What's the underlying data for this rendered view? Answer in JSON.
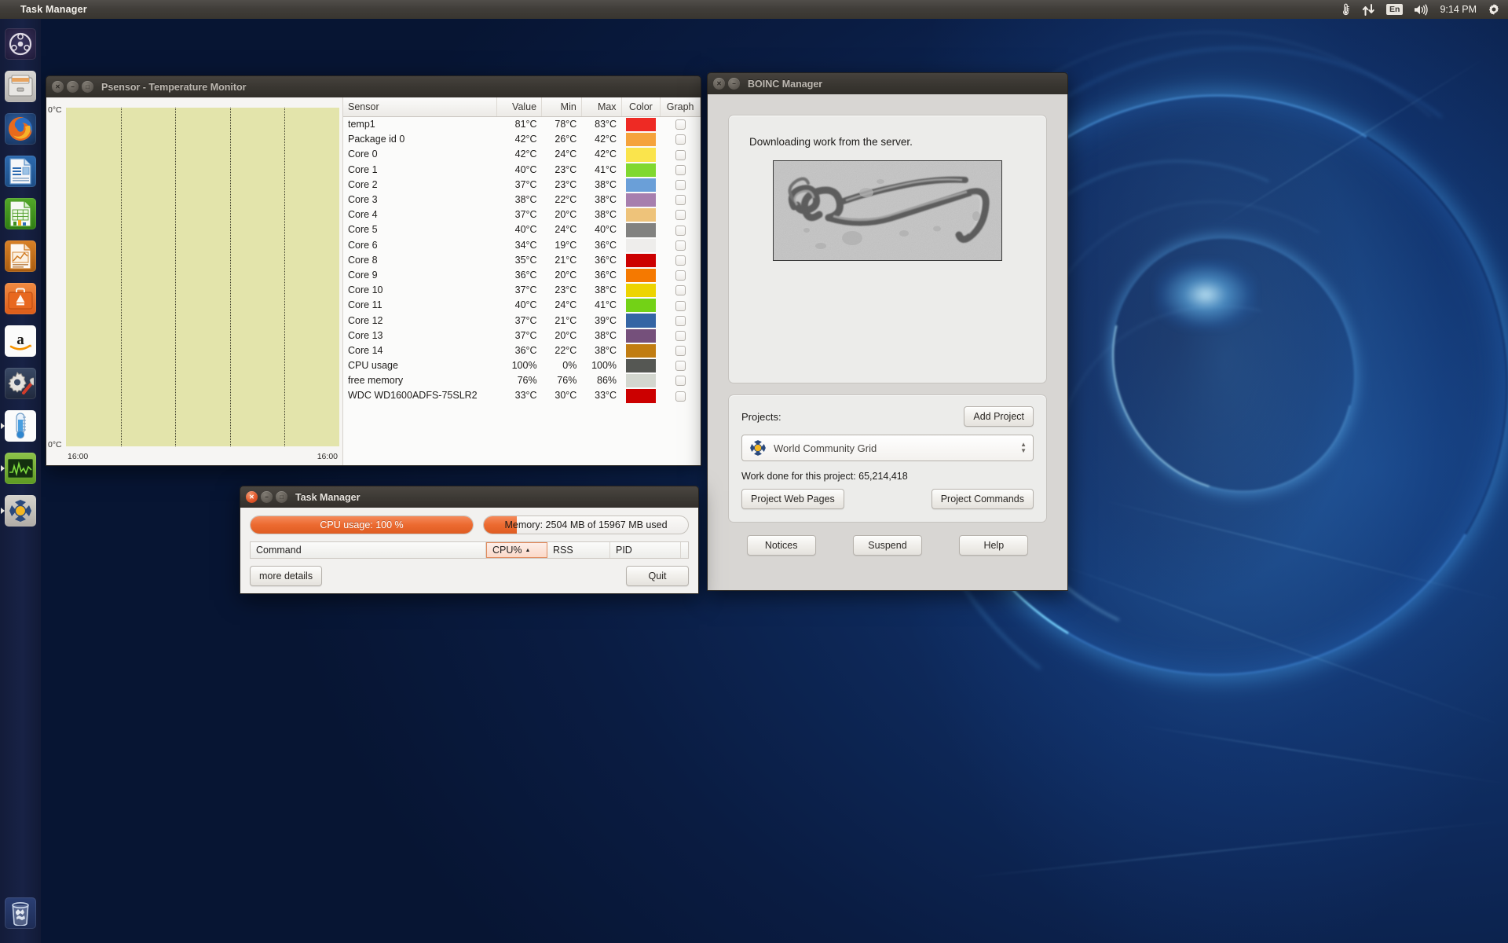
{
  "panel": {
    "title": "Task Manager",
    "clock": "9:14 PM",
    "indicators": [
      {
        "name": "thermometer-icon",
        "label": ""
      },
      {
        "name": "network-transfer-icon",
        "label": ""
      },
      {
        "name": "keyboard-layout-indicator",
        "label": "En"
      },
      {
        "name": "volume-icon",
        "label": ""
      },
      {
        "name": "session-gear-icon",
        "label": ""
      }
    ]
  },
  "launcher": {
    "items": [
      {
        "name": "ubuntu-dash",
        "label": "Dash Home"
      },
      {
        "name": "files",
        "label": "Files"
      },
      {
        "name": "firefox",
        "label": "Firefox Web Browser"
      },
      {
        "name": "writer",
        "label": "LibreOffice Writer"
      },
      {
        "name": "calc",
        "label": "LibreOffice Calc"
      },
      {
        "name": "impress",
        "label": "LibreOffice Impress"
      },
      {
        "name": "software-center",
        "label": "Ubuntu Software Center"
      },
      {
        "name": "amazon",
        "label": "Amazon"
      },
      {
        "name": "system-settings",
        "label": "System Settings"
      },
      {
        "name": "psensor",
        "label": "Psensor"
      },
      {
        "name": "system-monitor",
        "label": "System Monitor"
      },
      {
        "name": "boinc",
        "label": "BOINC Manager"
      }
    ],
    "trash": {
      "name": "trash",
      "label": "Trash"
    }
  },
  "psensor": {
    "title": "Psensor - Temperature Monitor",
    "graph": {
      "y_label_top": "0°C",
      "y_label_bottom": "0°C",
      "x_label_left": "16:00",
      "x_label_right": "16:00",
      "background_color": "#e3e4ab",
      "gridline_count": 4
    },
    "columns": [
      "Sensor",
      "Value",
      "Min",
      "Max",
      "Color",
      "Graph"
    ],
    "rows": [
      {
        "sensor": "temp1",
        "value": "81°C",
        "min": "78°C",
        "max": "83°C",
        "color": "#ee2a24",
        "graph": false
      },
      {
        "sensor": "Package id 0",
        "value": "42°C",
        "min": "26°C",
        "max": "42°C",
        "color": "#f5a33c",
        "graph": false
      },
      {
        "sensor": "Core 0",
        "value": "42°C",
        "min": "24°C",
        "max": "42°C",
        "color": "#fae44c",
        "graph": false
      },
      {
        "sensor": "Core 1",
        "value": "40°C",
        "min": "23°C",
        "max": "41°C",
        "color": "#80d830",
        "graph": false
      },
      {
        "sensor": "Core 2",
        "value": "37°C",
        "min": "23°C",
        "max": "38°C",
        "color": "#6a9fd8",
        "graph": false
      },
      {
        "sensor": "Core 3",
        "value": "38°C",
        "min": "22°C",
        "max": "38°C",
        "color": "#a77fae",
        "graph": false
      },
      {
        "sensor": "Core 4",
        "value": "37°C",
        "min": "20°C",
        "max": "38°C",
        "color": "#eec37a",
        "graph": false
      },
      {
        "sensor": "Core 5",
        "value": "40°C",
        "min": "24°C",
        "max": "40°C",
        "color": "#828280",
        "graph": false
      },
      {
        "sensor": "Core 6",
        "value": "34°C",
        "min": "19°C",
        "max": "36°C",
        "color": "#eeedeb",
        "graph": false
      },
      {
        "sensor": "Core 8",
        "value": "35°C",
        "min": "21°C",
        "max": "36°C",
        "color": "#cc0000",
        "graph": false
      },
      {
        "sensor": "Core 9",
        "value": "36°C",
        "min": "20°C",
        "max": "36°C",
        "color": "#f57900",
        "graph": false
      },
      {
        "sensor": "Core 10",
        "value": "37°C",
        "min": "23°C",
        "max": "38°C",
        "color": "#edd400",
        "graph": false
      },
      {
        "sensor": "Core 11",
        "value": "40°C",
        "min": "24°C",
        "max": "41°C",
        "color": "#73d216",
        "graph": false
      },
      {
        "sensor": "Core 12",
        "value": "37°C",
        "min": "21°C",
        "max": "39°C",
        "color": "#3465a4",
        "graph": false
      },
      {
        "sensor": "Core 13",
        "value": "37°C",
        "min": "20°C",
        "max": "38°C",
        "color": "#75507b",
        "graph": false
      },
      {
        "sensor": "Core 14",
        "value": "36°C",
        "min": "22°C",
        "max": "38°C",
        "color": "#c17d11",
        "graph": false
      },
      {
        "sensor": "CPU usage",
        "value": "100%",
        "min": "0%",
        "max": "100%",
        "color": "#555753",
        "graph": false
      },
      {
        "sensor": "free memory",
        "value": "76%",
        "min": "76%",
        "max": "86%",
        "color": "#d3d7cf",
        "graph": false
      },
      {
        "sensor": "WDC WD1600ADFS-75SLR2",
        "value": "33°C",
        "min": "30°C",
        "max": "33°C",
        "color": "#cc0000",
        "graph": false
      }
    ]
  },
  "boinc": {
    "title": "BOINC Manager",
    "status_text": "Downloading work from the server.",
    "image_caption": "ebola-virus-micrograph",
    "projects_label": "Projects:",
    "add_project_label": "Add Project",
    "selected_project": "World Community Grid",
    "work_done": "Work done for this project: 65,214,418",
    "project_web_pages_label": "Project Web Pages",
    "project_commands_label": "Project Commands",
    "notices_label": "Notices",
    "suspend_label": "Suspend",
    "help_label": "Help"
  },
  "taskmanager": {
    "title": "Task Manager",
    "cpu_label": "CPU usage: 100 %",
    "cpu_percent": 100,
    "memory_label": "Memory: 2504 MB of 15967 MB used",
    "memory_used_mb": 2504,
    "memory_total_mb": 15967,
    "memory_percent": 16,
    "columns": [
      "Command",
      "CPU%",
      "RSS",
      "PID"
    ],
    "sort_column": "CPU%",
    "more_details_label": "more details",
    "quit_label": "Quit"
  },
  "colors": {
    "ubuntu_orange": "#e8754a",
    "panel_bg": "#3d3a35",
    "desktop_blue": "#0e2a5c"
  }
}
